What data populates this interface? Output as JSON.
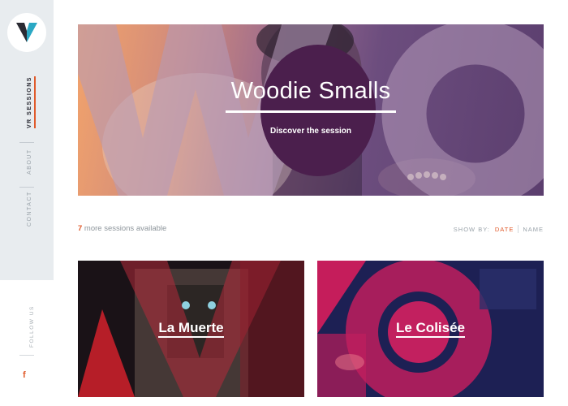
{
  "brand": {
    "logo_icon": "v-logo-icon",
    "accent": "#e05a2b"
  },
  "sidebar": {
    "nav": [
      {
        "label": "VR SESSIONS",
        "active": true
      },
      {
        "label": "ABOUT",
        "active": false
      },
      {
        "label": "CONTACT",
        "active": false
      }
    ],
    "follow_label": "FOLLOW US",
    "social_icon": "f"
  },
  "hero": {
    "title": "Woodie Smalls",
    "cta": "Discover the session",
    "bg_letters": "Wo"
  },
  "sessions": {
    "count": "7",
    "more_text": " more sessions available",
    "show_by_label": "SHOW BY:",
    "options": [
      {
        "label": "DATE",
        "active": true
      },
      {
        "label": "NAME",
        "active": false
      }
    ]
  },
  "cards": [
    {
      "title": "La Muerte"
    },
    {
      "title": "Le Colisée"
    }
  ]
}
